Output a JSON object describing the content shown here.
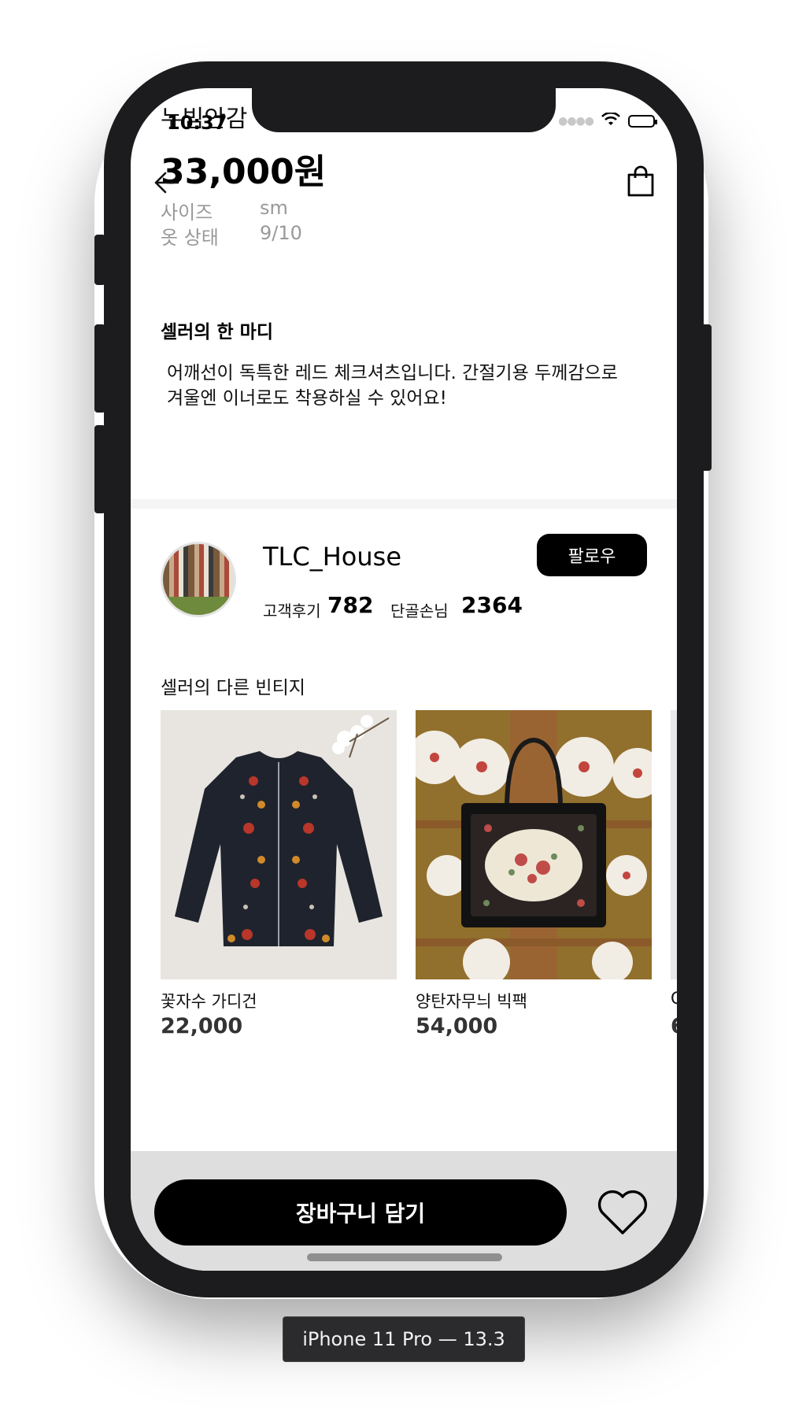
{
  "status_bar": {
    "time": "10:37"
  },
  "product": {
    "title": "누빔안감",
    "price": "33,000원",
    "specs": [
      {
        "label": "사이즈",
        "value": "sm"
      },
      {
        "label": "옷 상태",
        "value": "9/10"
      }
    ]
  },
  "seller_note": {
    "title": "셀러의 한 마디",
    "body": "어깨선이 독특한 레드 체크셔츠입니다. 간절기용 두께감으로 겨울엔 이너로도 착용하실 수 있어요!"
  },
  "shop": {
    "name": "TLC_House",
    "follow_label": "팔로우",
    "reviews_label": "고객후기",
    "reviews_count": "782",
    "regulars_label": "단골손님",
    "regulars_count": "2364"
  },
  "other_items": {
    "title": "셀러의 다른 빈티지",
    "items": [
      {
        "name": "꽃자수 가디건",
        "price": "22,000"
      },
      {
        "name": "양탄자무늬 빅팩",
        "price": "54,000"
      },
      {
        "name": "C",
        "price": "6"
      }
    ]
  },
  "bottom_bar": {
    "cart_label": "장바구니 담기"
  },
  "device_label": "iPhone 11 Pro — 13.3"
}
